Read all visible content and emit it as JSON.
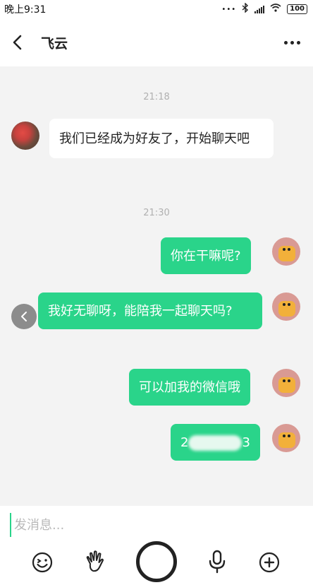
{
  "status_bar": {
    "time": "晚上9:31",
    "dots": "•••",
    "battery": "100"
  },
  "header": {
    "title": "飞云"
  },
  "messages": [
    {
      "timestamp": "21:18"
    },
    {
      "from": "friend",
      "text": "我们已经成为好友了，开始聊天吧"
    },
    {
      "timestamp": "21:30"
    },
    {
      "from": "me",
      "text": "你在干嘛呢?"
    },
    {
      "from": "me",
      "text": "我好无聊呀，能陪我一起聊天吗?"
    },
    {
      "from": "me",
      "text": "可以加我的微信哦"
    },
    {
      "from": "me",
      "text_prefix": "2",
      "text_suffix": "3"
    }
  ],
  "input": {
    "placeholder": "发消息..."
  },
  "toolbar": {
    "items": [
      "emoji-icon",
      "wave-hand-icon",
      "record-button",
      "microphone-icon",
      "plus-icon"
    ]
  },
  "colors": {
    "accent": "#2ad48a",
    "background": "#f3f3f3"
  }
}
